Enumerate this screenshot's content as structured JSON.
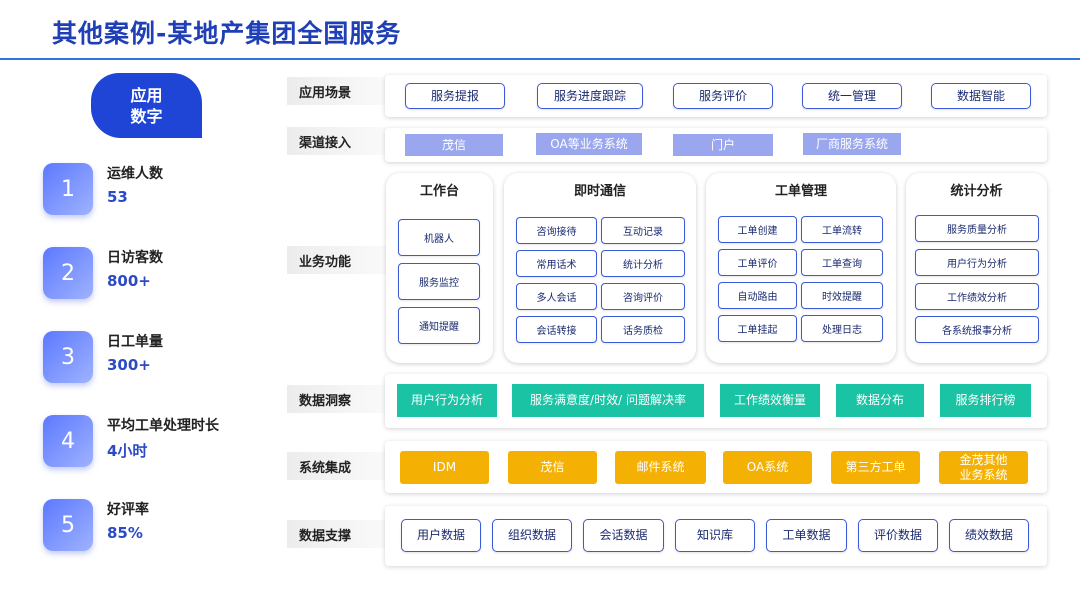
{
  "title": "其他案例-某地产集团全国服务",
  "metrics": {
    "badge_line1": "应用",
    "badge_line2": "数字",
    "items": [
      {
        "num": "1",
        "label": "运维人数",
        "value": "53"
      },
      {
        "num": "2",
        "label": "日访客数",
        "value": "800+"
      },
      {
        "num": "3",
        "label": "日工单量",
        "value": "300+"
      },
      {
        "num": "4",
        "label": "平均工单处理时长",
        "value": "4小时"
      },
      {
        "num": "5",
        "label": "好评率",
        "value": "85%"
      }
    ]
  },
  "rows": {
    "scenes": {
      "label": "应用场景",
      "items": [
        "服务提报",
        "服务进度跟踪",
        "服务评价",
        "统一管理",
        "数据智能"
      ]
    },
    "channels": {
      "label": "渠道接入",
      "items": [
        "茂信",
        "OA等业务系统",
        "门户",
        "厂商服务系统"
      ]
    },
    "business": {
      "label": "业务功能"
    },
    "insight": {
      "label": "数据洞察",
      "items": [
        "用户行为分析",
        "服务满意度/时效/ 问题解决率",
        "工作绩效衡量",
        "数据分布",
        "服务排行榜"
      ]
    },
    "integration": {
      "label": "系统集成",
      "items": [
        "IDM",
        "茂信",
        "邮件系统",
        "OA系统",
        "第三方工单",
        "金茂其他",
        "业务系统"
      ]
    },
    "support": {
      "label": "数据支撑",
      "items": [
        "用户数据",
        "组织数据",
        "会话数据",
        "知识库",
        "工单数据",
        "评价数据",
        "绩效数据"
      ]
    }
  },
  "cards": [
    {
      "title": "工作台",
      "items": [
        "机器人",
        "服务监控",
        "通知提醒"
      ]
    },
    {
      "title": "即时通信",
      "items": [
        "咨询接待",
        "互动记录",
        "常用话术",
        "统计分析",
        "多人会话",
        "咨询评价",
        "会话转接",
        "话务质检"
      ]
    },
    {
      "title": "工单管理",
      "items": [
        "工单创建",
        "工单流转",
        "工单评价",
        "工单查询",
        "自动路由",
        "时效提醒",
        "工单挂起",
        "处理日志"
      ]
    },
    {
      "title": "统计分析",
      "items": [
        "服务质量分析",
        "用户行为分析",
        "工作绩效分析",
        "各系统报事分析"
      ]
    }
  ]
}
